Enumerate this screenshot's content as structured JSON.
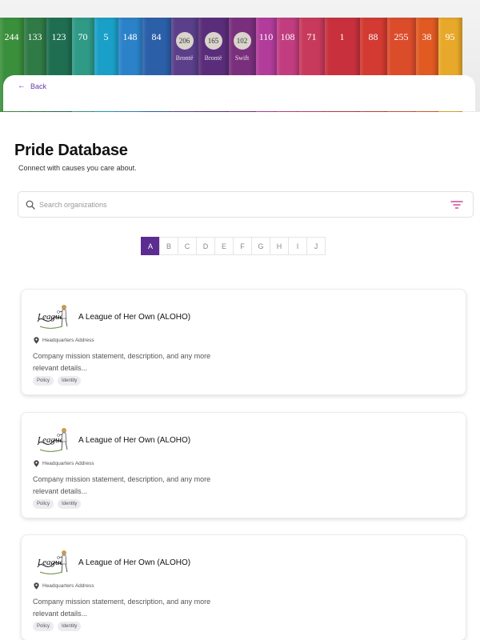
{
  "header": {
    "books": [
      {
        "num": "244",
        "color": "#3a8f3c"
      },
      {
        "num": "133",
        "color": "#2f7a45"
      },
      {
        "num": "123",
        "color": "#1f6e52"
      },
      {
        "num": "70",
        "color": "#2f9a86"
      },
      {
        "num": "5",
        "color": "#1aa0c8"
      },
      {
        "num": "148",
        "color": "#2b82c9"
      },
      {
        "num": "84",
        "color": "#2b5fa8"
      },
      {
        "num": "206",
        "color": "#5b3f8a",
        "author": "Brontë"
      },
      {
        "num": "165",
        "color": "#5a2d7a",
        "author": "Brontë"
      },
      {
        "num": "102",
        "color": "#7a2f7c",
        "author": "Swift"
      },
      {
        "num": "110",
        "color": "#b23c9a"
      },
      {
        "num": "108",
        "color": "#c23c80"
      },
      {
        "num": "71",
        "color": "#c83a5c"
      },
      {
        "num": "1",
        "color": "#c8303d"
      },
      {
        "num": "88",
        "color": "#d23a32"
      },
      {
        "num": "255",
        "color": "#db4c2b"
      },
      {
        "num": "38",
        "color": "#e05a22"
      },
      {
        "num": "95",
        "color": "#e8a92a"
      }
    ]
  },
  "nav": {
    "back_label": "Back"
  },
  "page": {
    "title": "Pride Database",
    "subtitle": "Connect with causes you care about."
  },
  "search": {
    "placeholder": "Search organizations",
    "value": ""
  },
  "alphabet": {
    "letters": [
      "A",
      "B",
      "C",
      "D",
      "E",
      "F",
      "G",
      "H",
      "I",
      "J"
    ],
    "active": "A"
  },
  "organizations": [
    {
      "name": "A League of Her Own (ALOHO)",
      "address_label": "Headquarters Address",
      "description": "Company mission statement, description, and any more relevant details...",
      "tags": [
        "Policy",
        "Identity"
      ],
      "logo_text": "League"
    },
    {
      "name": "A League of Her Own (ALOHO)",
      "address_label": "Headquarters Address",
      "description": "Company mission statement, description, and any more relevant details...",
      "tags": [
        "Policy",
        "Identity"
      ],
      "logo_text": "League"
    },
    {
      "name": "A League of Her Own (ALOHO)",
      "address_label": "Headquarters Address",
      "description": "Company mission statement, description, and any more relevant details...",
      "tags": [
        "Policy",
        "Identity"
      ],
      "logo_text": "League"
    }
  ],
  "icons": {
    "back": "arrow-left-icon",
    "search": "search-icon",
    "filter": "filter-icon",
    "location": "location-pin-icon"
  },
  "colors": {
    "accent": "#5b2d91",
    "filter_icon": "#c0267e",
    "link": "#6a3aa8"
  }
}
